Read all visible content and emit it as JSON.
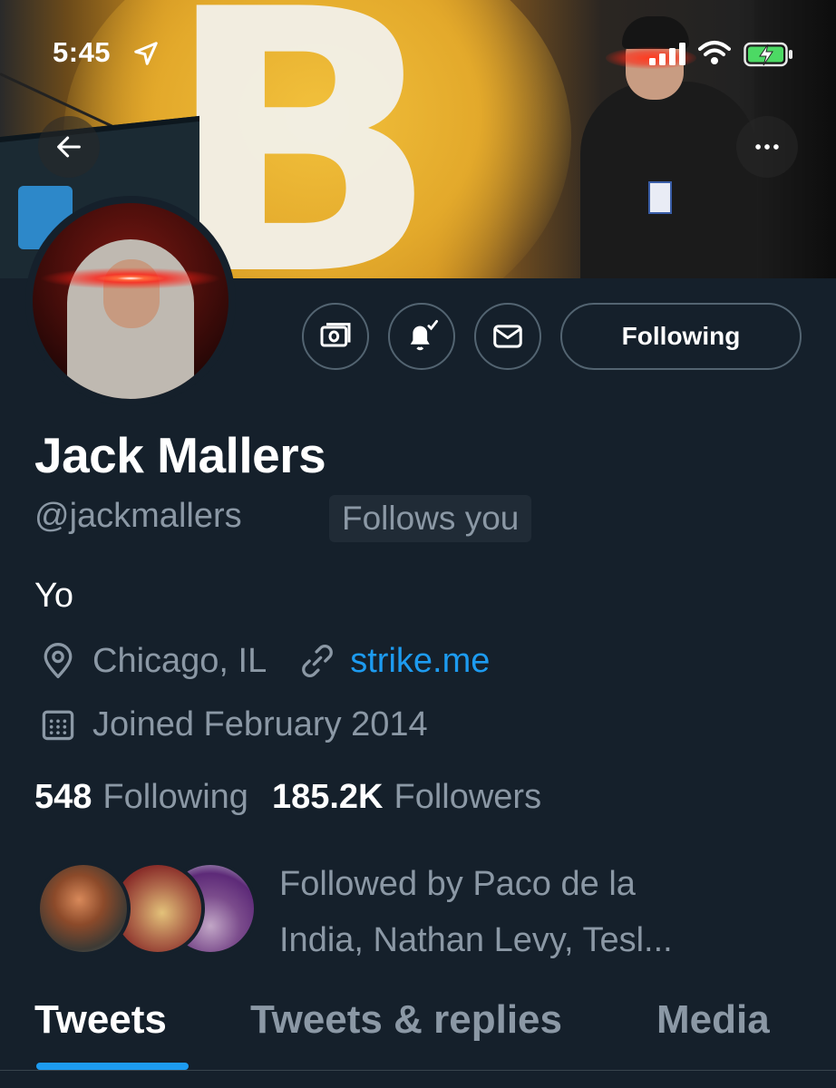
{
  "status_bar": {
    "time": "5:45",
    "icons": [
      "location-arrow-icon",
      "cellular-signal-icon",
      "wifi-icon",
      "battery-charging-icon"
    ]
  },
  "header": {
    "back_icon": "arrow-left-icon",
    "more_icon": "ellipsis-icon"
  },
  "actions": {
    "tip_icon": "money-icon",
    "notify_icon": "bell-check-icon",
    "message_icon": "envelope-icon",
    "following_label": "Following"
  },
  "profile": {
    "name": "Jack Mallers",
    "handle": "@jackmallers",
    "follows_you": "Follows you",
    "bio": "Yo",
    "location": "Chicago, IL",
    "website": "strike.me",
    "joined": "Joined February 2014",
    "following_count": "548",
    "following_label": "Following",
    "followers_count": "185.2K",
    "followers_label": "Followers",
    "followed_by_line1": "Followed by Paco de la",
    "followed_by_line2": "India, Nathan Levy, Tesl..."
  },
  "tabs": [
    {
      "label": "Tweets",
      "active": true
    },
    {
      "label": "Tweets & replies",
      "active": false
    },
    {
      "label": "Media",
      "active": false
    }
  ],
  "colors": {
    "background": "#15202b",
    "accent": "#1d9bf0",
    "secondary_text": "#8b98a5",
    "border": "#536471"
  }
}
